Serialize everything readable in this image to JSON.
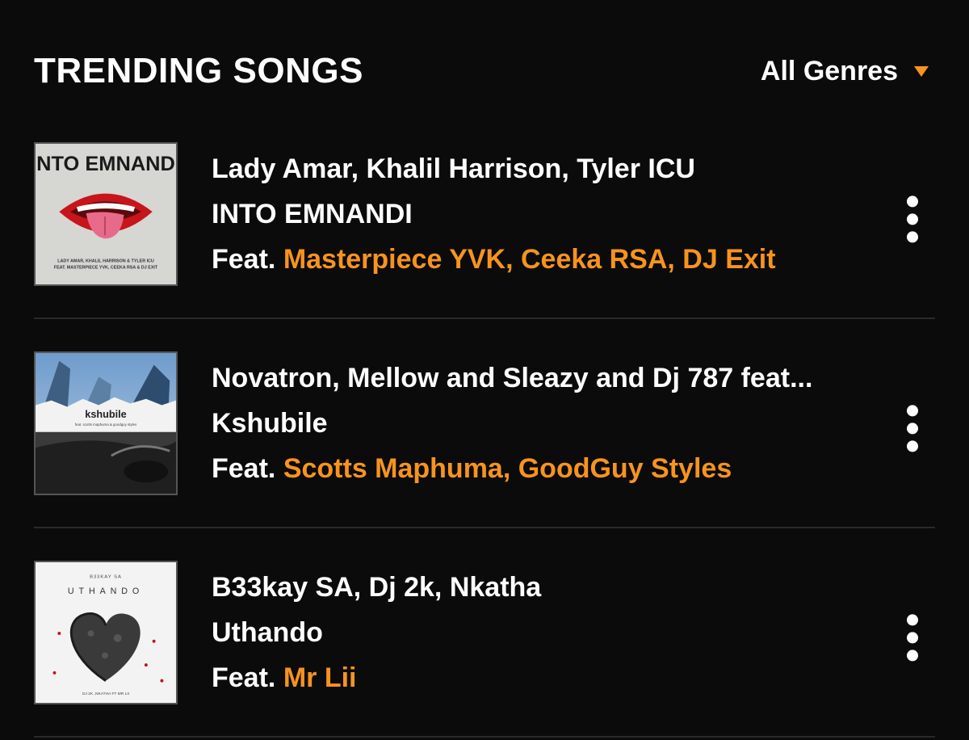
{
  "header": {
    "title": "TRENDING SONGS",
    "genre_filter": "All Genres",
    "accent_color": "#f7931e"
  },
  "songs": [
    {
      "artists": "Lady Amar, Khalil Harrison, Tyler ICU",
      "title": "INTO EMNANDI",
      "feat_prefix": "Feat.",
      "featured": "Masterpiece YVK, Ceeka RSA, DJ Exit",
      "cover_text": "INTO EMNANDI",
      "cover_credits": "LADY AMAR, KHALIL HARRISON & TYLER ICU",
      "cover_credits_2": "FEAT. MASTERPIECE YVK, CEEKA RSA & DJ EXIT"
    },
    {
      "artists": "Novatron, Mellow and Sleazy and Dj 787 feat...",
      "title": "Kshubile",
      "feat_prefix": "Feat.",
      "featured": "Scotts Maphuma, GoodGuy Styles",
      "cover_text": "kshubile",
      "cover_credits": "feat. scotts maphuma & goodguy styles"
    },
    {
      "artists": "B33kay SA, Dj 2k, Nkatha",
      "title": "Uthando",
      "feat_prefix": "Feat.",
      "featured": "Mr Lii",
      "cover_top": "B33KAY SA",
      "cover_text": "UTHANDO",
      "cover_credits": "DJ 2K ,NKATHA FT MR LII"
    }
  ]
}
